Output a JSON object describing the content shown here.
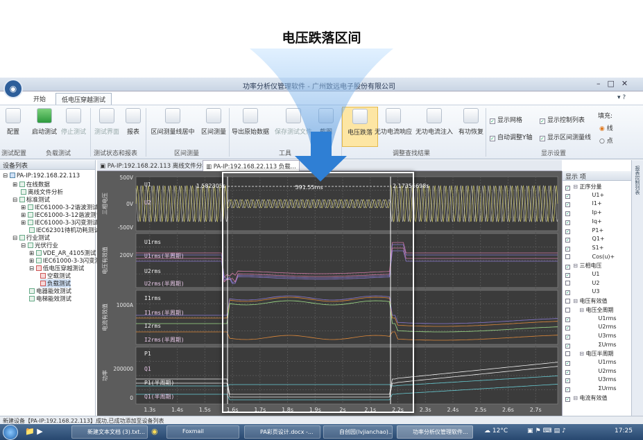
{
  "headline": "电压跌落区间",
  "window_title": "功率分析仪管理软件 - 广州致远电子股份有限公司",
  "tabs": {
    "start": "开始",
    "active": "低电压穿越测试"
  },
  "ribbon": {
    "buttons": [
      {
        "label": "配置",
        "enabled": true
      },
      {
        "label": "启动测试",
        "enabled": true
      },
      {
        "label": "停止测试",
        "enabled": false
      },
      {
        "label": "测试界面",
        "enabled": false
      },
      {
        "label": "报表",
        "enabled": true
      },
      {
        "label": "区间测量线居中",
        "enabled": true
      },
      {
        "label": "区间测量",
        "enabled": true
      },
      {
        "label": "导出原始数据",
        "enabled": true
      },
      {
        "label": "保存测试文件",
        "enabled": false
      },
      {
        "label": "截图",
        "enabled": true
      },
      {
        "label": "电压跌落",
        "enabled": true
      },
      {
        "label": "无功电流响应",
        "enabled": true
      },
      {
        "label": "无功电流注入",
        "enabled": true
      },
      {
        "label": "有功恢复",
        "enabled": true
      }
    ],
    "groups": [
      "测试配置",
      "负载测试",
      "测试状态和报表",
      "区间测量",
      "工具",
      "调整查找结果",
      "显示设置"
    ],
    "checks": [
      {
        "label": "显示网格",
        "checked": true
      },
      {
        "label": "自动调整Y轴",
        "checked": true
      },
      {
        "label": "显示控制列表",
        "checked": true
      },
      {
        "label": "显示区间测量线",
        "checked": true
      }
    ],
    "fill_label": "填充:",
    "fill_options": [
      "线",
      "点"
    ]
  },
  "left_pane": {
    "title": "设备列表",
    "items": [
      "PA-IP:192.168.22.113",
      "在线数据",
      "离线文件分析",
      "标准测试",
      "IEC61000-3-2谐波测试",
      "IEC61000-3-12谐波测试",
      "IEC61000-3-3闪变测试",
      "IEC62301待机功耗测试",
      "行业测试",
      "光伏行业",
      "VDE_AR_4105测试",
      "IEC61000-3-3闪变测",
      "低电压穿越测试",
      "空载测试",
      "负载测试",
      "电器能效测试",
      "电梯能效测试"
    ]
  },
  "doc_tabs": [
    "PA-IP:192.168.22.113 离线文件分析",
    "PA-IP:192.168.22.113 负载..."
  ],
  "chart_data": {
    "type": "line",
    "panels": [
      {
        "ylabel": "三相电压",
        "yticks": [
          "500V",
          "0V",
          "-500V"
        ],
        "series": [
          "U1",
          "U2"
        ]
      },
      {
        "ylabel": "电压有效值",
        "yticks": [
          "200V"
        ],
        "series": [
          "U1rms",
          "U1rms(半周期)",
          "U2rms",
          "U2rms(半周期)"
        ]
      },
      {
        "ylabel": "电流有效值",
        "yticks": [
          "1000A"
        ],
        "series": [
          "I1rms",
          "I1rms(半周期)",
          "I2rms",
          "I2rms(半周期)"
        ]
      },
      {
        "ylabel": "功率",
        "yticks": [
          "200000",
          "0"
        ],
        "series": [
          "P1",
          "Q1",
          "P1(半周期)",
          "Q1(半周期)"
        ]
      }
    ],
    "xticks": [
      "1.3s",
      "1.4s",
      "1.5s",
      "1.6s",
      "1.7s",
      "1.8s",
      "1.9s",
      "2s",
      "2.1s",
      "2.2s",
      "2.3s",
      "2.4s",
      "2.5s",
      "2.6s",
      "2.7s"
    ],
    "cursor_left": "1.582305s",
    "cursor_right": "2.17356698s",
    "interval": "591.55ms"
  },
  "right_pane": {
    "header": "显示 项",
    "rows": [
      {
        "label": "正序分量",
        "checked": true,
        "indent": 1
      },
      {
        "label": "U1+",
        "checked": true,
        "indent": 3
      },
      {
        "label": "I1+",
        "checked": true,
        "indent": 3
      },
      {
        "label": "Ip+",
        "checked": true,
        "indent": 3
      },
      {
        "label": "Iq+",
        "checked": true,
        "indent": 3
      },
      {
        "label": "P1+",
        "checked": true,
        "indent": 3
      },
      {
        "label": "Q1+",
        "checked": true,
        "indent": 3
      },
      {
        "label": "S1+",
        "checked": true,
        "indent": 3
      },
      {
        "label": "Cos(u)+",
        "checked": false,
        "indent": 3
      },
      {
        "label": "三相电压",
        "checked": true,
        "indent": 1
      },
      {
        "label": "U1",
        "checked": true,
        "indent": 3
      },
      {
        "label": "U2",
        "checked": false,
        "indent": 3
      },
      {
        "label": "U3",
        "checked": true,
        "indent": 3
      },
      {
        "label": "电压有效值",
        "checked": false,
        "indent": 1
      },
      {
        "label": "电压全周期",
        "checked": false,
        "indent": 2
      },
      {
        "label": "U1rms",
        "checked": true,
        "indent": 4
      },
      {
        "label": "U2rms",
        "checked": true,
        "indent": 4
      },
      {
        "label": "U3rms",
        "checked": true,
        "indent": 4
      },
      {
        "label": "ΣUrms",
        "checked": true,
        "indent": 4
      },
      {
        "label": "电压半周期",
        "checked": false,
        "indent": 2
      },
      {
        "label": "U1rms",
        "checked": true,
        "indent": 4
      },
      {
        "label": "U2rms",
        "checked": true,
        "indent": 4
      },
      {
        "label": "U3rms",
        "checked": true,
        "indent": 4
      },
      {
        "label": "ΣUrms",
        "checked": true,
        "indent": 4
      },
      {
        "label": "电流有效值",
        "checked": true,
        "indent": 1
      }
    ]
  },
  "side_strip": "报表控制列表",
  "status_text": "新建设备【PA-IP:192.168.22.113】成功,已成功添加至设备列表",
  "taskbar": {
    "items": [
      "新建文本文档 (3).txt...",
      "Foxmail",
      "PA彩页设计.docx -...",
      "自创园(lvjianchao)...",
      "功率分析仪管理软件..."
    ],
    "weather": "12°C",
    "time": "17:25"
  },
  "colors": {
    "accent": "#2f7fd4",
    "u1": "#e8e070",
    "u2": "#c8c8c8",
    "rms1": "#d27aa6",
    "rms2": "#8a7ad2",
    "i1": "#e08a3a",
    "i2": "#a0e08a",
    "p1": "#f0f0f0",
    "q1": "#6ad0d8"
  }
}
